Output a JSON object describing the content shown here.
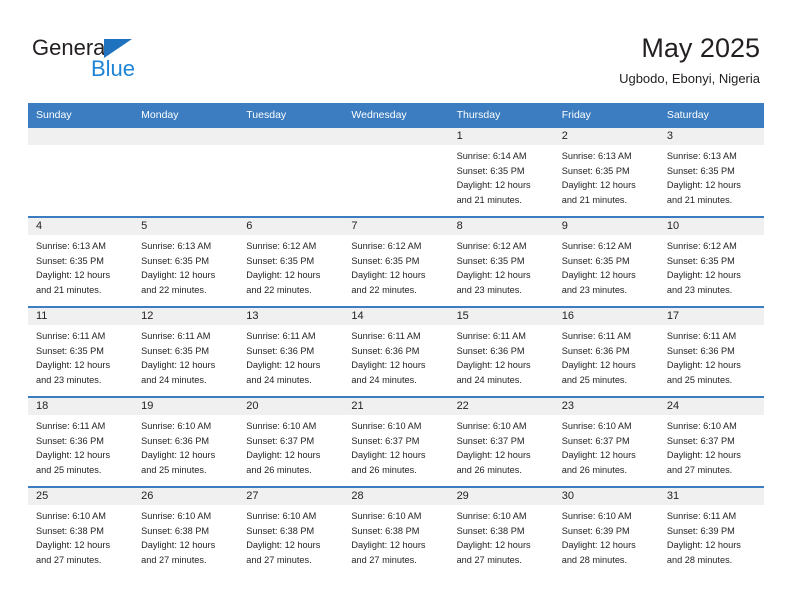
{
  "brand": {
    "name_part1": "General",
    "name_part2": "Blue",
    "triangle_icon": "triangle-icon",
    "colors": {
      "dark": "#231f20",
      "blue": "#1f84d6",
      "triangle": "#1f72bd"
    }
  },
  "header": {
    "title": "May 2025",
    "location": "Ugbodo, Ebonyi, Nigeria"
  },
  "colors": {
    "header_row_bg": "#3b7dc0",
    "header_row_text": "#ffffff",
    "daynum_band_bg": "#f0f0f0",
    "cell_bg": "#ffffff",
    "text": "#231f20"
  },
  "weekday_headers": [
    "Sunday",
    "Monday",
    "Tuesday",
    "Wednesday",
    "Thursday",
    "Friday",
    "Saturday"
  ],
  "weeks": [
    [
      {
        "day": "",
        "sunrise": "",
        "sunset": "",
        "daylight_line1": "",
        "daylight_line2": "",
        "empty": true
      },
      {
        "day": "",
        "sunrise": "",
        "sunset": "",
        "daylight_line1": "",
        "daylight_line2": "",
        "empty": true
      },
      {
        "day": "",
        "sunrise": "",
        "sunset": "",
        "daylight_line1": "",
        "daylight_line2": "",
        "empty": true
      },
      {
        "day": "",
        "sunrise": "",
        "sunset": "",
        "daylight_line1": "",
        "daylight_line2": "",
        "empty": true
      },
      {
        "day": "1",
        "sunrise": "Sunrise: 6:14 AM",
        "sunset": "Sunset: 6:35 PM",
        "daylight_line1": "Daylight: 12 hours",
        "daylight_line2": "and 21 minutes.",
        "empty": false
      },
      {
        "day": "2",
        "sunrise": "Sunrise: 6:13 AM",
        "sunset": "Sunset: 6:35 PM",
        "daylight_line1": "Daylight: 12 hours",
        "daylight_line2": "and 21 minutes.",
        "empty": false
      },
      {
        "day": "3",
        "sunrise": "Sunrise: 6:13 AM",
        "sunset": "Sunset: 6:35 PM",
        "daylight_line1": "Daylight: 12 hours",
        "daylight_line2": "and 21 minutes.",
        "empty": false
      }
    ],
    [
      {
        "day": "4",
        "sunrise": "Sunrise: 6:13 AM",
        "sunset": "Sunset: 6:35 PM",
        "daylight_line1": "Daylight: 12 hours",
        "daylight_line2": "and 21 minutes.",
        "empty": false
      },
      {
        "day": "5",
        "sunrise": "Sunrise: 6:13 AM",
        "sunset": "Sunset: 6:35 PM",
        "daylight_line1": "Daylight: 12 hours",
        "daylight_line2": "and 22 minutes.",
        "empty": false
      },
      {
        "day": "6",
        "sunrise": "Sunrise: 6:12 AM",
        "sunset": "Sunset: 6:35 PM",
        "daylight_line1": "Daylight: 12 hours",
        "daylight_line2": "and 22 minutes.",
        "empty": false
      },
      {
        "day": "7",
        "sunrise": "Sunrise: 6:12 AM",
        "sunset": "Sunset: 6:35 PM",
        "daylight_line1": "Daylight: 12 hours",
        "daylight_line2": "and 22 minutes.",
        "empty": false
      },
      {
        "day": "8",
        "sunrise": "Sunrise: 6:12 AM",
        "sunset": "Sunset: 6:35 PM",
        "daylight_line1": "Daylight: 12 hours",
        "daylight_line2": "and 23 minutes.",
        "empty": false
      },
      {
        "day": "9",
        "sunrise": "Sunrise: 6:12 AM",
        "sunset": "Sunset: 6:35 PM",
        "daylight_line1": "Daylight: 12 hours",
        "daylight_line2": "and 23 minutes.",
        "empty": false
      },
      {
        "day": "10",
        "sunrise": "Sunrise: 6:12 AM",
        "sunset": "Sunset: 6:35 PM",
        "daylight_line1": "Daylight: 12 hours",
        "daylight_line2": "and 23 minutes.",
        "empty": false
      }
    ],
    [
      {
        "day": "11",
        "sunrise": "Sunrise: 6:11 AM",
        "sunset": "Sunset: 6:35 PM",
        "daylight_line1": "Daylight: 12 hours",
        "daylight_line2": "and 23 minutes.",
        "empty": false
      },
      {
        "day": "12",
        "sunrise": "Sunrise: 6:11 AM",
        "sunset": "Sunset: 6:35 PM",
        "daylight_line1": "Daylight: 12 hours",
        "daylight_line2": "and 24 minutes.",
        "empty": false
      },
      {
        "day": "13",
        "sunrise": "Sunrise: 6:11 AM",
        "sunset": "Sunset: 6:36 PM",
        "daylight_line1": "Daylight: 12 hours",
        "daylight_line2": "and 24 minutes.",
        "empty": false
      },
      {
        "day": "14",
        "sunrise": "Sunrise: 6:11 AM",
        "sunset": "Sunset: 6:36 PM",
        "daylight_line1": "Daylight: 12 hours",
        "daylight_line2": "and 24 minutes.",
        "empty": false
      },
      {
        "day": "15",
        "sunrise": "Sunrise: 6:11 AM",
        "sunset": "Sunset: 6:36 PM",
        "daylight_line1": "Daylight: 12 hours",
        "daylight_line2": "and 24 minutes.",
        "empty": false
      },
      {
        "day": "16",
        "sunrise": "Sunrise: 6:11 AM",
        "sunset": "Sunset: 6:36 PM",
        "daylight_line1": "Daylight: 12 hours",
        "daylight_line2": "and 25 minutes.",
        "empty": false
      },
      {
        "day": "17",
        "sunrise": "Sunrise: 6:11 AM",
        "sunset": "Sunset: 6:36 PM",
        "daylight_line1": "Daylight: 12 hours",
        "daylight_line2": "and 25 minutes.",
        "empty": false
      }
    ],
    [
      {
        "day": "18",
        "sunrise": "Sunrise: 6:11 AM",
        "sunset": "Sunset: 6:36 PM",
        "daylight_line1": "Daylight: 12 hours",
        "daylight_line2": "and 25 minutes.",
        "empty": false
      },
      {
        "day": "19",
        "sunrise": "Sunrise: 6:10 AM",
        "sunset": "Sunset: 6:36 PM",
        "daylight_line1": "Daylight: 12 hours",
        "daylight_line2": "and 25 minutes.",
        "empty": false
      },
      {
        "day": "20",
        "sunrise": "Sunrise: 6:10 AM",
        "sunset": "Sunset: 6:37 PM",
        "daylight_line1": "Daylight: 12 hours",
        "daylight_line2": "and 26 minutes.",
        "empty": false
      },
      {
        "day": "21",
        "sunrise": "Sunrise: 6:10 AM",
        "sunset": "Sunset: 6:37 PM",
        "daylight_line1": "Daylight: 12 hours",
        "daylight_line2": "and 26 minutes.",
        "empty": false
      },
      {
        "day": "22",
        "sunrise": "Sunrise: 6:10 AM",
        "sunset": "Sunset: 6:37 PM",
        "daylight_line1": "Daylight: 12 hours",
        "daylight_line2": "and 26 minutes.",
        "empty": false
      },
      {
        "day": "23",
        "sunrise": "Sunrise: 6:10 AM",
        "sunset": "Sunset: 6:37 PM",
        "daylight_line1": "Daylight: 12 hours",
        "daylight_line2": "and 26 minutes.",
        "empty": false
      },
      {
        "day": "24",
        "sunrise": "Sunrise: 6:10 AM",
        "sunset": "Sunset: 6:37 PM",
        "daylight_line1": "Daylight: 12 hours",
        "daylight_line2": "and 27 minutes.",
        "empty": false
      }
    ],
    [
      {
        "day": "25",
        "sunrise": "Sunrise: 6:10 AM",
        "sunset": "Sunset: 6:38 PM",
        "daylight_line1": "Daylight: 12 hours",
        "daylight_line2": "and 27 minutes.",
        "empty": false
      },
      {
        "day": "26",
        "sunrise": "Sunrise: 6:10 AM",
        "sunset": "Sunset: 6:38 PM",
        "daylight_line1": "Daylight: 12 hours",
        "daylight_line2": "and 27 minutes.",
        "empty": false
      },
      {
        "day": "27",
        "sunrise": "Sunrise: 6:10 AM",
        "sunset": "Sunset: 6:38 PM",
        "daylight_line1": "Daylight: 12 hours",
        "daylight_line2": "and 27 minutes.",
        "empty": false
      },
      {
        "day": "28",
        "sunrise": "Sunrise: 6:10 AM",
        "sunset": "Sunset: 6:38 PM",
        "daylight_line1": "Daylight: 12 hours",
        "daylight_line2": "and 27 minutes.",
        "empty": false
      },
      {
        "day": "29",
        "sunrise": "Sunrise: 6:10 AM",
        "sunset": "Sunset: 6:38 PM",
        "daylight_line1": "Daylight: 12 hours",
        "daylight_line2": "and 27 minutes.",
        "empty": false
      },
      {
        "day": "30",
        "sunrise": "Sunrise: 6:10 AM",
        "sunset": "Sunset: 6:39 PM",
        "daylight_line1": "Daylight: 12 hours",
        "daylight_line2": "and 28 minutes.",
        "empty": false
      },
      {
        "day": "31",
        "sunrise": "Sunrise: 6:11 AM",
        "sunset": "Sunset: 6:39 PM",
        "daylight_line1": "Daylight: 12 hours",
        "daylight_line2": "and 28 minutes.",
        "empty": false
      }
    ]
  ]
}
